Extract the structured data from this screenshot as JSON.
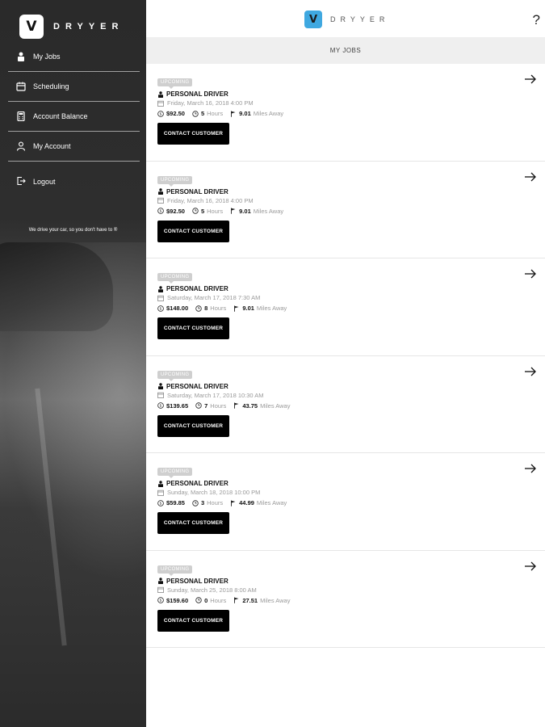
{
  "sidebar": {
    "brand_logo": "V",
    "brand_name": "DRYYER",
    "items": [
      {
        "label": "My Jobs",
        "icon": "person-icon"
      },
      {
        "label": "Scheduling",
        "icon": "calendar-icon"
      },
      {
        "label": "Account Balance",
        "icon": "calculator-icon"
      },
      {
        "label": "My Account",
        "icon": "user-outline-icon"
      }
    ],
    "logout": "Logout",
    "tagline": "We drive your car, so you don't have to ®"
  },
  "header": {
    "logo": "V",
    "name": "DRYYER",
    "help": "?"
  },
  "subheader": "MY JOBS",
  "jobs": [
    {
      "badge": "UPCOMING",
      "title": "PERSONAL DRIVER",
      "date": "Friday, March 16, 2018 4:00 PM",
      "price": "$92.50",
      "hours": "5",
      "hours_unit": "Hours",
      "miles": "9.01",
      "miles_unit": "Miles Away",
      "button": "CONTACT CUSTOMER"
    },
    {
      "badge": "UPCOMING",
      "title": "PERSONAL DRIVER",
      "date": "Friday, March 16, 2018 4:00 PM",
      "price": "$92.50",
      "hours": "5",
      "hours_unit": "Hours",
      "miles": "9.01",
      "miles_unit": "Miles Away",
      "button": "CONTACT CUSTOMER"
    },
    {
      "badge": "UPCOMING",
      "title": "PERSONAL DRIVER",
      "date": "Saturday, March 17, 2018 7:30 AM",
      "price": "$148.00",
      "hours": "8",
      "hours_unit": "Hours",
      "miles": "9.01",
      "miles_unit": "Miles Away",
      "button": "CONTACT CUSTOMER"
    },
    {
      "badge": "UPCOMING",
      "title": "PERSONAL DRIVER",
      "date": "Saturday, March 17, 2018 10:30 AM",
      "price": "$139.65",
      "hours": "7",
      "hours_unit": "Hours",
      "miles": "43.75",
      "miles_unit": "Miles Away",
      "button": "CONTACT CUSTOMER"
    },
    {
      "badge": "UPCOMING",
      "title": "PERSONAL DRIVER",
      "date": "Sunday, March 18, 2018 10:00 PM",
      "price": "$59.85",
      "hours": "3",
      "hours_unit": "Hours",
      "miles": "44.99",
      "miles_unit": "Miles Away",
      "button": "CONTACT CUSTOMER"
    },
    {
      "badge": "UPCOMING",
      "title": "PERSONAL DRIVER",
      "date": "Sunday, March 25, 2018 8:00 AM",
      "price": "$159.60",
      "hours": "0",
      "hours_unit": "Hours",
      "miles": "27.51",
      "miles_unit": "Miles Away",
      "button": "CONTACT CUSTOMER"
    }
  ]
}
